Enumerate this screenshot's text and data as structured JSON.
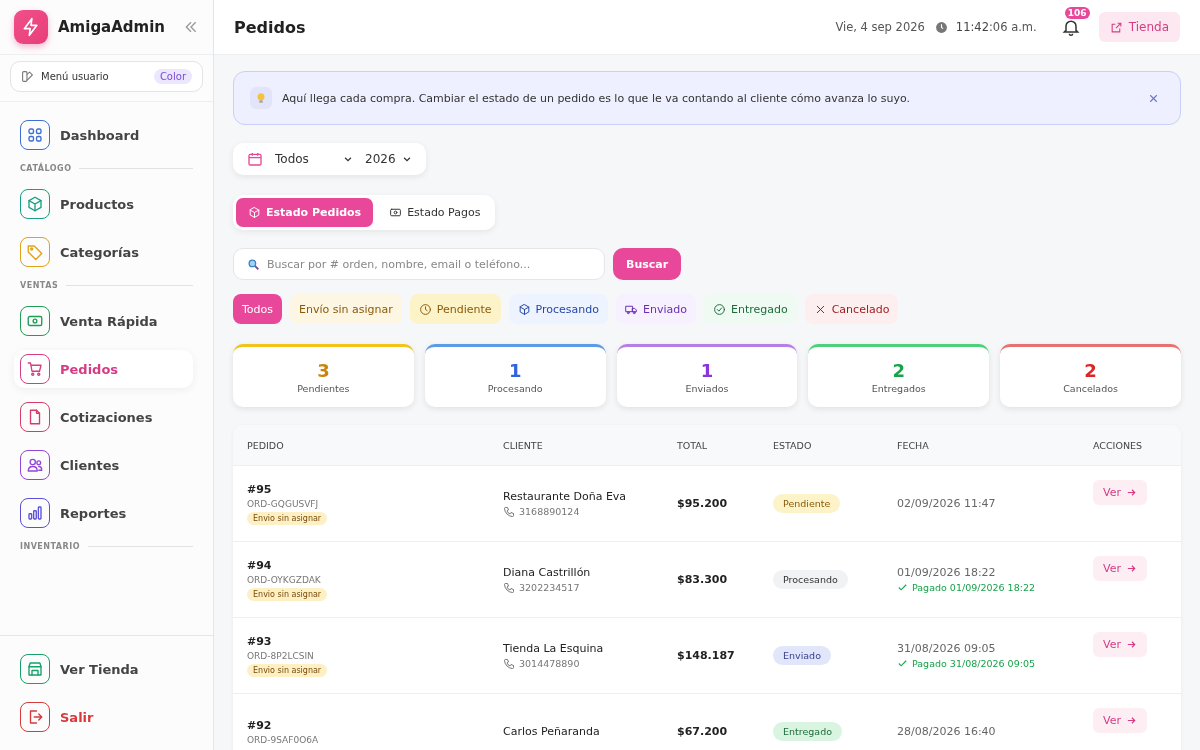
{
  "sidebar": {
    "brand": "AmigaAdmin",
    "user_menu": {
      "label": "Menú usuario",
      "badge": "Color"
    },
    "groups": [
      {
        "items": [
          {
            "label": "Dashboard",
            "color": "#3b6fd1",
            "selected": false
          }
        ]
      },
      {
        "heading": "CATÁLOGO",
        "items": [
          {
            "label": "Productos",
            "color": "#16a085",
            "selected": false
          },
          {
            "label": "Categorías",
            "color": "#e0a21a",
            "selected": false
          }
        ]
      },
      {
        "heading": "VENTAS",
        "items": [
          {
            "label": "Venta Rápida",
            "color": "#1f9d55",
            "selected": false
          },
          {
            "label": "Pedidos",
            "color": "#d63c83",
            "selected": true
          },
          {
            "label": "Cotizaciones",
            "color": "#d63c6a",
            "selected": false
          },
          {
            "label": "Clientes",
            "color": "#9146d6",
            "selected": false
          },
          {
            "label": "Reportes",
            "color": "#5a4fd6",
            "selected": false
          }
        ]
      },
      {
        "heading": "INVENTARIO"
      }
    ],
    "footer": [
      {
        "label": "Ver Tienda",
        "color": "#16a06a",
        "danger": false
      },
      {
        "label": "Salir",
        "color": "#d63a3a",
        "danger": true
      }
    ]
  },
  "header": {
    "title": "Pedidos",
    "date": "Vie, 4 sep 2026",
    "time": "11:42",
    "seconds": ":06",
    "ampm": "a.m.",
    "notifications": "106",
    "store_button": "Tienda"
  },
  "notice": {
    "text": "Aquí llega cada compra. Cambiar el estado de un pedido es lo que le va contando al cliente cómo avanza lo suyo."
  },
  "period": {
    "month": "Todos",
    "year": "2026"
  },
  "tabs": [
    {
      "label": "Estado Pedidos",
      "selected": true
    },
    {
      "label": "Estado Pagos",
      "selected": false
    }
  ],
  "search": {
    "placeholder": "Buscar por # orden, nombre, email o teléfono...",
    "button": "Buscar"
  },
  "filters": [
    {
      "label": "Todos",
      "kind": "all",
      "selected": true
    },
    {
      "label": "Envío sin asignar",
      "kind": "unassigned",
      "selected": false
    },
    {
      "label": "Pendiente",
      "kind": "pending",
      "selected": false
    },
    {
      "label": "Procesando",
      "kind": "processing",
      "selected": false
    },
    {
      "label": "Enviado",
      "kind": "shipped",
      "selected": false
    },
    {
      "label": "Entregado",
      "kind": "delivered",
      "selected": false
    },
    {
      "label": "Cancelado",
      "kind": "cancelled",
      "selected": false
    }
  ],
  "summary": [
    {
      "value": "3",
      "label": "Pendientes",
      "kind": "pending"
    },
    {
      "value": "1",
      "label": "Procesando",
      "kind": "processing"
    },
    {
      "value": "1",
      "label": "Enviados",
      "kind": "shipped"
    },
    {
      "value": "2",
      "label": "Entregados",
      "kind": "delivered"
    },
    {
      "value": "2",
      "label": "Cancelados",
      "kind": "cancelled"
    }
  ],
  "table": {
    "columns": [
      "PEDIDO",
      "CLIENTE",
      "TOTAL",
      "ESTADO",
      "FECHA",
      "ACCIONES"
    ],
    "rows": [
      {
        "number": "#95",
        "code": "ORD-GQGUSVFJ",
        "shipping": "Envio sin asignar",
        "customer": "Restaurante Doña Eva",
        "phone": "3168890124",
        "total": "$95.200",
        "status": {
          "label": "Pendiente",
          "kind": "pending"
        },
        "date": "02/09/2026 11:47",
        "payment": null,
        "action": "Ver"
      },
      {
        "number": "#94",
        "code": "ORD-OYKGZDAK",
        "shipping": "Envio sin asignar",
        "customer": "Diana Castrillón",
        "phone": "3202234517",
        "total": "$83.300",
        "status": {
          "label": "Procesando",
          "kind": "processing"
        },
        "date": "01/09/2026 18:22",
        "payment": "Pagado 01/09/2026 18:22",
        "action": "Ver"
      },
      {
        "number": "#93",
        "code": "ORD-8P2LCSIN",
        "shipping": "Envio sin asignar",
        "customer": "Tienda La Esquina",
        "phone": "3014478890",
        "total": "$148.187",
        "status": {
          "label": "Enviado",
          "kind": "shipped"
        },
        "date": "31/08/2026 09:05",
        "payment": "Pagado 31/08/2026 09:05",
        "action": "Ver"
      },
      {
        "number": "#92",
        "code": "ORD-9SAF0O6A",
        "shipping": null,
        "customer": "Carlos Peñaranda",
        "phone": null,
        "total": "$67.200",
        "status": {
          "label": "Entregado",
          "kind": "delivered"
        },
        "date": "28/08/2026 16:40",
        "payment": null,
        "action": "Ver"
      }
    ]
  }
}
